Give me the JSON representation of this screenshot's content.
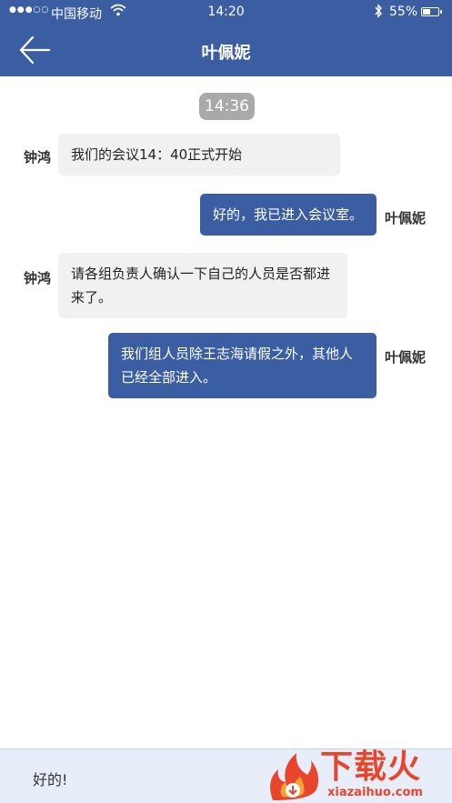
{
  "status_bar": {
    "signal": "●●●○○",
    "carrier": "中国移动",
    "time": "14:20",
    "battery_text": "55%",
    "battery_level": 0.55
  },
  "nav": {
    "title": "叶佩妮"
  },
  "chat": {
    "timestamp": "14:36",
    "messages": [
      {
        "sender": "钟鸿",
        "direction": "in",
        "text": "我们的会议14：40正式开始"
      },
      {
        "sender": "叶佩妮",
        "direction": "out",
        "text": "好的，我已进入会议室。"
      },
      {
        "sender": "钟鸿",
        "direction": "in",
        "text": "请各组负责人确认一下自己的人员是否都进来了。"
      },
      {
        "sender": "叶佩妮",
        "direction": "out",
        "text": "我们组人员除王志海请假之外，其他人已经全部进入。"
      }
    ]
  },
  "input": {
    "value": "好的!"
  },
  "watermark": {
    "title": "下载火",
    "site": "xiazaihuo.com"
  },
  "colors": {
    "primary": "#3b5ea3",
    "incoming_bubble": "#f1f1f1",
    "input_bar": "#e7eefa",
    "watermark": "#e8452c"
  }
}
